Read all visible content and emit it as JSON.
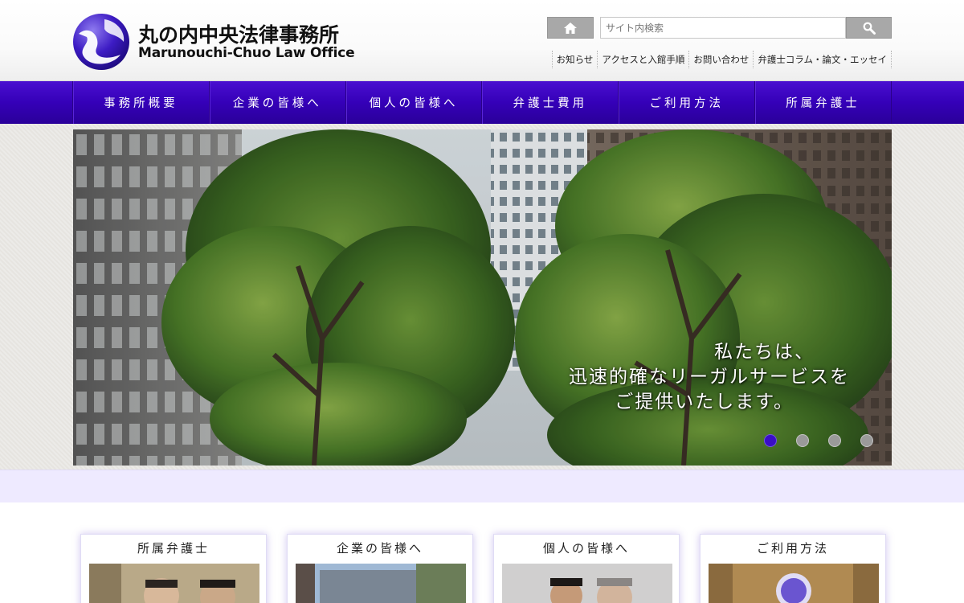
{
  "header": {
    "logo_ja": "丸の内中央法律事務所",
    "logo_en": "Marunouchi-Chuo Law Office",
    "search": {
      "placeholder": "サイト内検索",
      "value": ""
    },
    "icons": {
      "home": "home-icon",
      "search": "magnifier-icon",
      "logo": "logo-mark-icon"
    },
    "util_links": [
      {
        "label": "お知らせ"
      },
      {
        "label": "アクセスと入館手順"
      },
      {
        "label": "お問い合わせ"
      },
      {
        "label": "弁護士コラム・論文・エッセイ"
      }
    ]
  },
  "nav": {
    "items": [
      {
        "label": "事務所概要"
      },
      {
        "label": "企業の皆様へ"
      },
      {
        "label": "個人の皆様へ"
      },
      {
        "label": "弁護士費用"
      },
      {
        "label": "ご利用方法"
      },
      {
        "label": "所属弁護士"
      }
    ]
  },
  "hero": {
    "caption_line1": "私たちは、",
    "caption_line2": "迅速的確なリーガルサービスを",
    "caption_line3": "ご提供いたします。",
    "slide_count": 4,
    "active_slide": 1
  },
  "cards": [
    {
      "title": "所属弁護士"
    },
    {
      "title": "企業の皆様へ"
    },
    {
      "title": "個人の皆様へ"
    },
    {
      "title": "ご利用方法"
    }
  ],
  "colors": {
    "nav_bg": "#3500b8",
    "accent": "#3a0ec6",
    "strip_bg": "#eeeaff"
  }
}
